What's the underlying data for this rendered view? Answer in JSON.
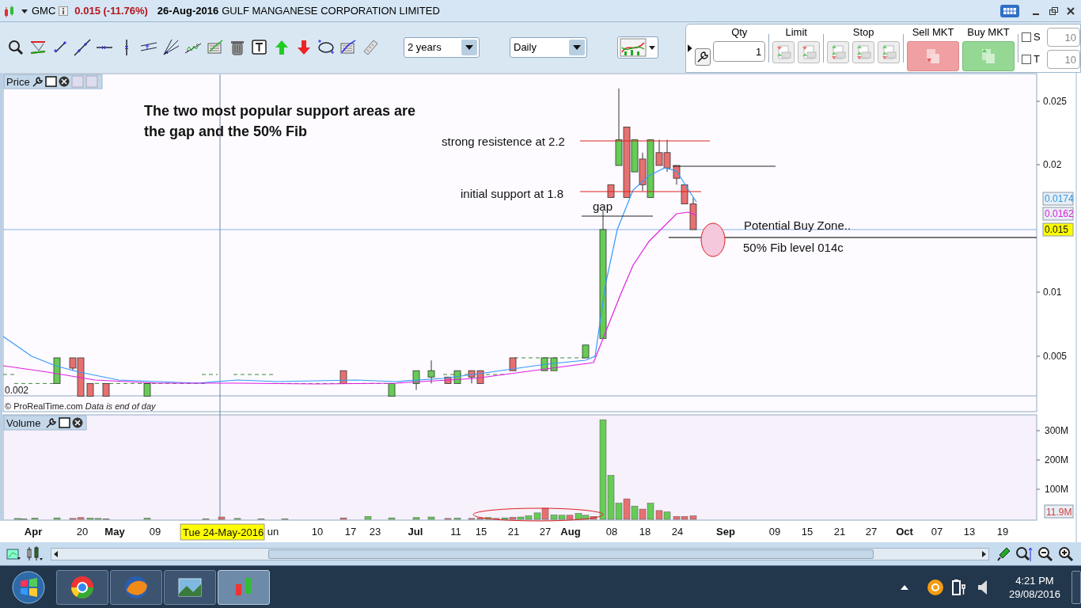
{
  "title_bar": {
    "symbol": "GMC",
    "price_change": "0.015 (-11.76%)",
    "date": "26-Aug-2016",
    "company": "GULF MANGANESE CORPORATION LIMITED"
  },
  "toolbar": {
    "period": "2 years",
    "interval": "Daily"
  },
  "order_panel": {
    "qty_label": "Qty",
    "qty": "1",
    "limit_label": "Limit",
    "stop_label": "Stop",
    "sell_label": "Sell MKT",
    "buy_label": "Buy MKT",
    "options": [
      {
        "label": "S",
        "checked": false,
        "value": "10"
      },
      {
        "label": "T",
        "checked": false,
        "value": "10"
      }
    ]
  },
  "price_panel": {
    "title": "Price",
    "headline": [
      "The two most popular support areas are",
      " the gap and the 50% Fib"
    ],
    "annotations": [
      "strong resistence at 2.2",
      "initial support at 1.8",
      "gap",
      "Potential Buy Zone..",
      "50% Fib level 014c"
    ],
    "y_ticks": [
      "0.025",
      "0.02",
      "0.01",
      "0.005"
    ],
    "badges": [
      {
        "text": "0.0174",
        "color": "#2e9be6",
        "highlighted": false
      },
      {
        "text": "0.0162",
        "color": "#e020e0",
        "highlighted": false
      },
      {
        "text": "0.015",
        "highlighted": true
      }
    ],
    "low_label": "0.002",
    "footer": "© ProRealTime.com *Data is end of day*"
  },
  "volume_panel": {
    "title": "Volume",
    "y_ticks": [
      "300M",
      "200M",
      "100M"
    ],
    "badge": "11.9M"
  },
  "x_axis": {
    "labels": [
      {
        "text": "Apr",
        "month": true
      },
      {
        "text": "20",
        "month": false
      },
      {
        "text": "May",
        "month": true
      },
      {
        "text": "09",
        "month": false
      },
      {
        "text": "un",
        "month": false
      },
      {
        "text": "10",
        "month": false
      },
      {
        "text": "17",
        "month": false
      },
      {
        "text": "23",
        "month": false
      },
      {
        "text": "Jul",
        "month": true
      },
      {
        "text": "11",
        "month": false
      },
      {
        "text": "15",
        "month": false
      },
      {
        "text": "21",
        "month": false
      },
      {
        "text": "27",
        "month": false
      },
      {
        "text": "Aug",
        "month": true
      },
      {
        "text": "08",
        "month": false
      },
      {
        "text": "18",
        "month": false
      },
      {
        "text": "24",
        "month": false
      },
      {
        "text": "Sep",
        "month": true
      },
      {
        "text": "09",
        "month": false
      },
      {
        "text": "15",
        "month": false
      },
      {
        "text": "21",
        "month": false
      },
      {
        "text": "27",
        "month": false
      },
      {
        "text": "Oct",
        "month": true
      },
      {
        "text": "07",
        "month": false
      },
      {
        "text": "13",
        "month": false
      },
      {
        "text": "19",
        "month": false
      }
    ],
    "tooltip": "Tue 24-May-2016"
  },
  "taskbar": {
    "time": "4:21 PM",
    "date": "29/08/2016"
  }
}
